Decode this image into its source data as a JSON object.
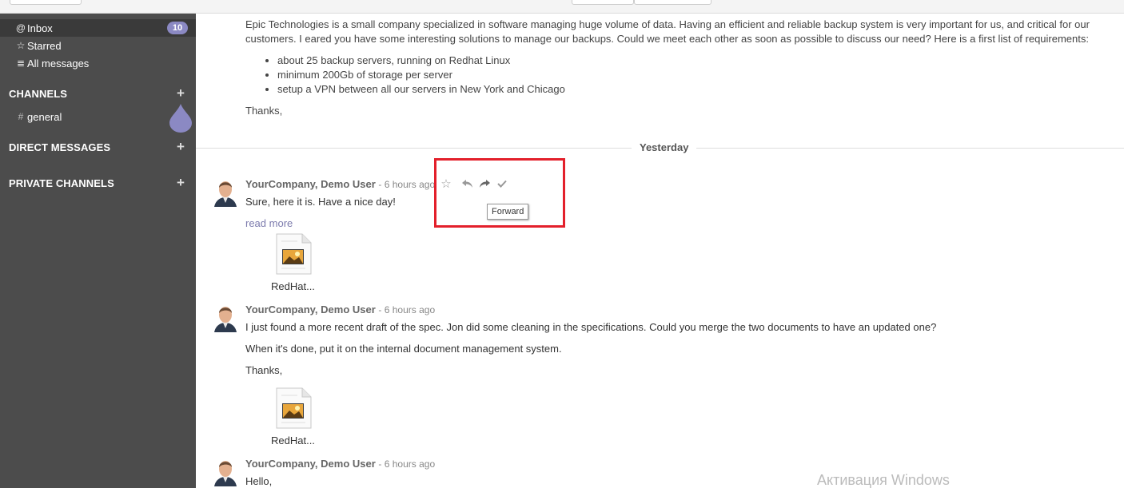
{
  "sidebar": {
    "items": [
      {
        "icon": "@",
        "icon_name": "at-icon",
        "label": "Inbox",
        "badge": "10"
      },
      {
        "icon": "☆",
        "icon_name": "star-icon",
        "label": "Starred"
      },
      {
        "icon": "≣",
        "icon_name": "database-icon",
        "label": "All messages"
      }
    ],
    "sections": {
      "channels": "CHANNELS",
      "direct": "DIRECT MESSAGES",
      "private": "PRIVATE CHANNELS"
    },
    "channel": {
      "icon": "#",
      "label": "general"
    }
  },
  "thread": {
    "intro": {
      "paragraph": "Epic Technologies is a small company specialized in software managing huge volume of data. Having an efficient and reliable backup system is very important for us, and critical for our customers. I eared you have some interesting solutions to manage our backups. Could we meet each other as soon as possible to discuss our need? Here is a first list of requirements:",
      "requirements": [
        "about 25 backup servers, running on Redhat Linux",
        "minimum 200Gb of storage per server",
        "setup a VPN between all our servers in New York and Chicago"
      ],
      "thanks": "Thanks,"
    },
    "divider": "Yesterday",
    "messages": [
      {
        "author": "YourCompany, Demo User",
        "time": "- 6 hours ago",
        "lines": [
          "Sure, here it is. Have a nice day!"
        ],
        "read_more": "read more",
        "attachment": "RedHat..."
      },
      {
        "author": "YourCompany, Demo User",
        "time": "- 6 hours ago",
        "lines": [
          "I just found a more recent draft of the spec. Jon did some cleaning in the specifications. Could you merge the two documents to have an updated one?",
          "When it's done, put it on the internal document management system.",
          "Thanks,"
        ],
        "attachment": "RedHat..."
      },
      {
        "author": "YourCompany, Demo User",
        "time": "- 6 hours ago",
        "lines": [
          "Hello,"
        ]
      }
    ],
    "actions": {
      "tooltip": "Forward"
    }
  },
  "watermark": "Активация Windows",
  "colors": {
    "sidebar_bg": "#4c4c4c",
    "badge": "#8b89c3",
    "link": "#7c7bad",
    "highlight": "#e3202b"
  }
}
